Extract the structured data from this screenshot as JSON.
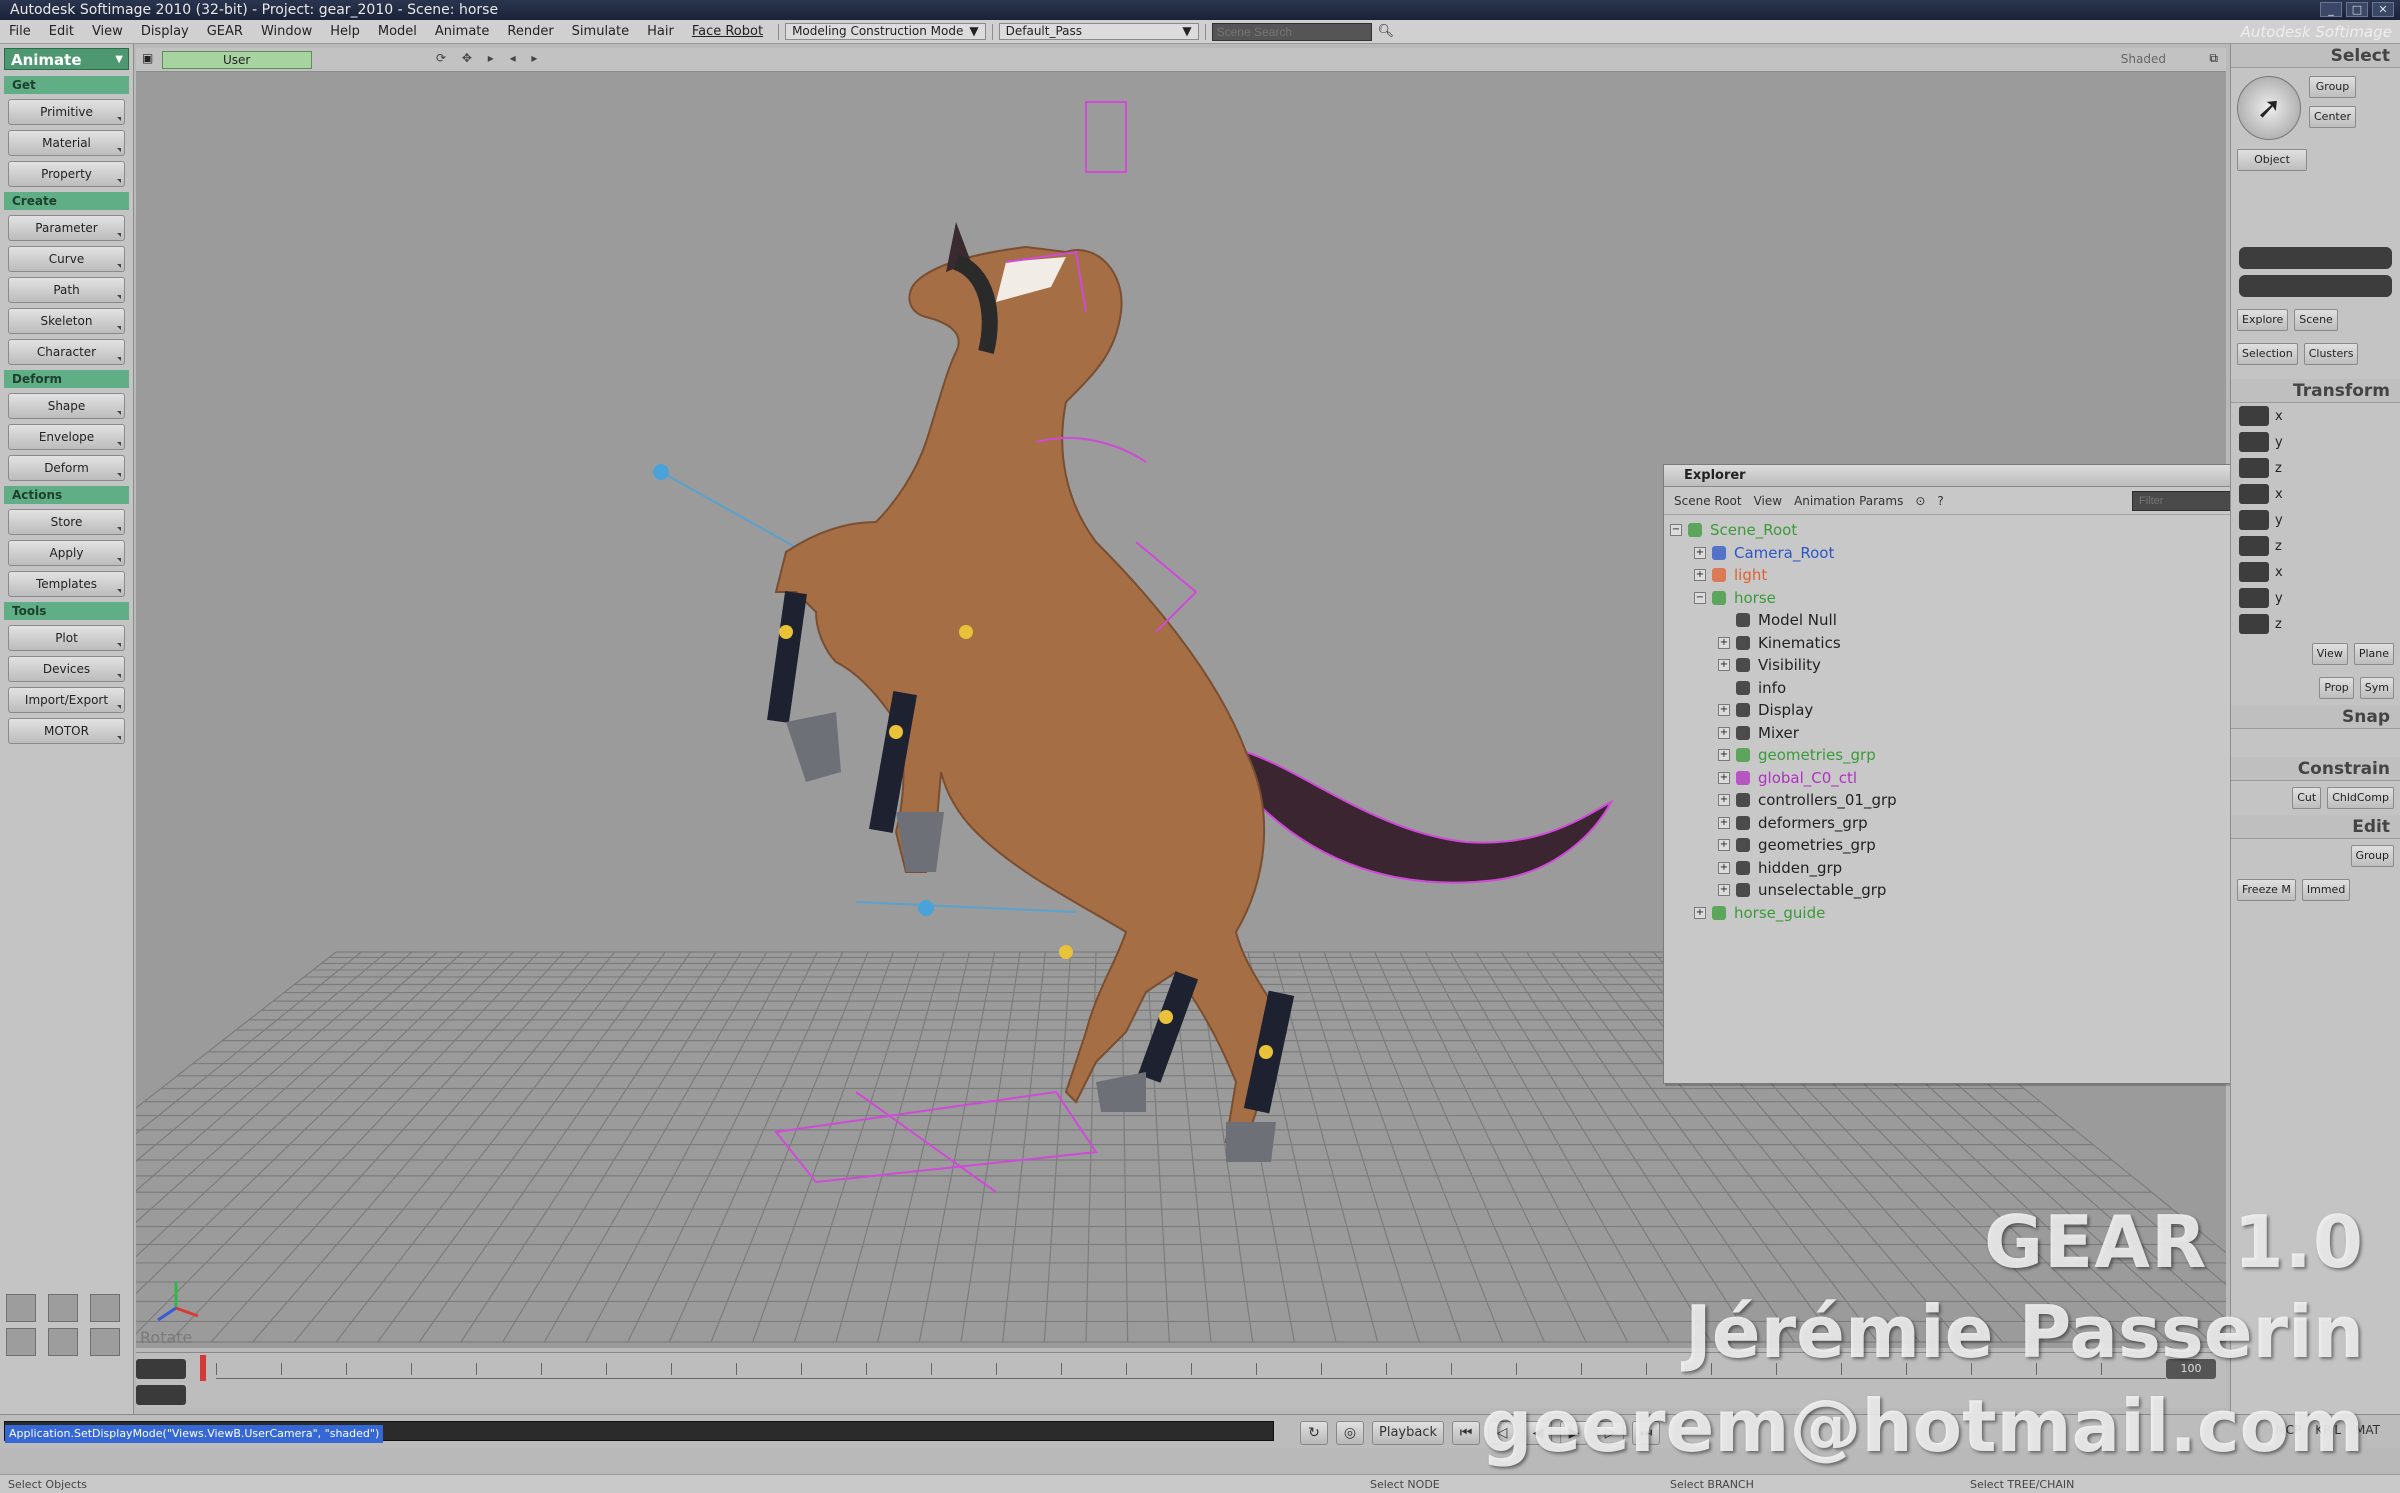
{
  "window": {
    "title": "Autodesk Softimage 2010 (32-bit) - Project: gear_2010 - Scene: horse",
    "brand": "Autodesk Softimage"
  },
  "menus": [
    "File",
    "Edit",
    "View",
    "Display",
    "GEAR",
    "Window",
    "Help",
    "Model",
    "Animate",
    "Render",
    "Simulate",
    "Hair",
    "Face Robot"
  ],
  "menu_combo": "Modeling Construction Mode",
  "layer_combo": "Default_Pass",
  "scene_search_placeholder": "Scene Search",
  "left_toolbar": {
    "mode": "Animate",
    "sections": [
      {
        "header": "Get",
        "buttons": [
          "Primitive",
          "Material",
          "Property"
        ]
      },
      {
        "header": "Create",
        "buttons": [
          "Parameter",
          "Curve",
          "Path",
          "Skeleton",
          "Character"
        ]
      },
      {
        "header": "Deform",
        "buttons": [
          "Shape",
          "Envelope",
          "Deform"
        ]
      },
      {
        "header": "Actions",
        "buttons": [
          "Store",
          "Apply",
          "Templates"
        ]
      },
      {
        "header": "Tools",
        "buttons": [
          "Plot",
          "Devices",
          "Import/Export",
          "MOTOR"
        ]
      }
    ]
  },
  "viewport": {
    "camera": "User",
    "display_mode": "Shaded",
    "rotate_label": "Rotate"
  },
  "explorer": {
    "title": "Explorer",
    "toolbar": [
      "Scene Root",
      "View",
      "Animation Params"
    ],
    "filter_placeholder": "Filter",
    "items": [
      {
        "label": "Scene_Root",
        "depth": 0,
        "expander": "−",
        "color": "#3a9a3a",
        "icon": "scene-icon"
      },
      {
        "label": "Camera_Root",
        "depth": 1,
        "expander": "+",
        "color": "#2c56c8",
        "icon": "camera-icon"
      },
      {
        "label": "light",
        "depth": 1,
        "expander": "+",
        "color": "#e06030",
        "icon": "light-icon"
      },
      {
        "label": "horse",
        "depth": 1,
        "expander": "−",
        "color": "#3a9a3a",
        "icon": "model-icon"
      },
      {
        "label": "Model Null",
        "depth": 2,
        "expander": "",
        "color": "#222222",
        "icon": "null-icon"
      },
      {
        "label": "Kinematics",
        "depth": 2,
        "expander": "+",
        "color": "#222222",
        "icon": "kinematics-icon"
      },
      {
        "label": "Visibility",
        "depth": 2,
        "expander": "+",
        "color": "#222222",
        "icon": "visibility-icon"
      },
      {
        "label": "info",
        "depth": 2,
        "expander": "",
        "color": "#222222",
        "icon": "info-icon"
      },
      {
        "label": "Display",
        "depth": 2,
        "expander": "+",
        "color": "#222222",
        "icon": "display-icon"
      },
      {
        "label": "Mixer",
        "depth": 2,
        "expander": "+",
        "color": "#222222",
        "icon": "mixer-icon"
      },
      {
        "label": "geometries_grp",
        "depth": 2,
        "expander": "+",
        "color": "#3a9a3a",
        "icon": "group-icon"
      },
      {
        "label": "global_C0_ctl",
        "depth": 2,
        "expander": "+",
        "color": "#b030c0",
        "icon": "control-icon"
      },
      {
        "label": "controllers_01_grp",
        "depth": 2,
        "expander": "+",
        "color": "#222222",
        "icon": "group-icon"
      },
      {
        "label": "deformers_grp",
        "depth": 2,
        "expander": "+",
        "color": "#222222",
        "icon": "group-icon"
      },
      {
        "label": "geometries_grp",
        "depth": 2,
        "expander": "+",
        "color": "#222222",
        "icon": "group-icon"
      },
      {
        "label": "hidden_grp",
        "depth": 2,
        "expander": "+",
        "color": "#222222",
        "icon": "group-icon"
      },
      {
        "label": "unselectable_grp",
        "depth": 2,
        "expander": "+",
        "color": "#222222",
        "icon": "group-icon"
      },
      {
        "label": "horse_guide",
        "depth": 1,
        "expander": "+",
        "color": "#3a9a3a",
        "icon": "model-icon"
      }
    ]
  },
  "right_panel": {
    "header": "Select",
    "buttons_top": [
      "Group",
      "Center"
    ],
    "object_btn": "Object",
    "buttons_mid": [
      "Explore",
      "Scene",
      "Selection",
      "Clusters"
    ],
    "transform_header": "Transform",
    "axes": [
      "x",
      "y",
      "z",
      "x",
      "y",
      "z",
      "x",
      "y",
      "z"
    ],
    "buttons_low": [
      "View",
      "Plane",
      "Prop",
      "Sym"
    ],
    "snap_header": "Snap",
    "constrain_header": "Constrain",
    "constrain_btns": [
      "Cut",
      "ChldComp"
    ],
    "edit_header": "Edit",
    "edit_btns": [
      "Group",
      "Freeze M",
      "Immed"
    ]
  },
  "timeline": {
    "end_frame": "100"
  },
  "command_line": "Application.SetDisplayMode(\"Views.ViewB.UserCamera\", \"shaded\")",
  "playback": {
    "label": "Playback",
    "right_labels": [
      "MCP",
      "KP/L",
      "MAT"
    ]
  },
  "status": {
    "left": "Select Objects",
    "mid1": "Select NODE",
    "mid2": "Select BRANCH",
    "right": "Select TREE/CHAIN"
  },
  "watermark": {
    "line1": "GEAR 1.0",
    "line2": "Jérémie Passerin",
    "line3": "geerem@hotmail.com"
  },
  "colors": {
    "accent_green": "#5fae86",
    "mode_green": "#4d9870",
    "horse_body": "#a56e45",
    "rig_magenta": "#d04ad8"
  }
}
